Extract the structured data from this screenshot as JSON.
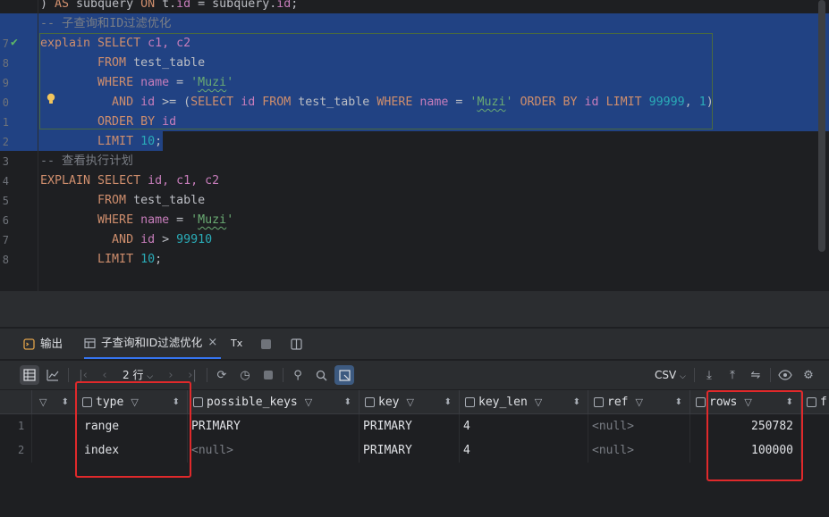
{
  "editor": {
    "lines": [
      {
        "n": "",
        "parts": [
          {
            "t": ") ",
            "c": "id"
          },
          {
            "t": "AS",
            "c": "kw"
          },
          {
            "t": " subquery ",
            "c": "id"
          },
          {
            "t": "ON",
            "c": "kw"
          },
          {
            "t": " t.",
            "c": "id"
          },
          {
            "t": "id",
            "c": "kw2"
          },
          {
            "t": " = subquery.",
            "c": "id"
          },
          {
            "t": "id",
            "c": "kw2"
          },
          {
            "t": ";",
            "c": "id"
          }
        ]
      },
      {
        "n": "",
        "parts": [
          {
            "t": "-- 子查询和ID过滤优化",
            "c": "cm"
          }
        ]
      },
      {
        "n": "7",
        "parts": [
          {
            "t": "explain ",
            "c": "kw"
          },
          {
            "t": "SELECT",
            "c": "kw"
          },
          {
            "t": " c1, c2",
            "c": "kw2"
          }
        ]
      },
      {
        "n": "8",
        "parts": [
          {
            "t": "        FROM",
            "c": "kw"
          },
          {
            "t": " test_table",
            "c": "id"
          }
        ]
      },
      {
        "n": "9",
        "parts": [
          {
            "t": "        WHERE",
            "c": "kw"
          },
          {
            "t": " name",
            "c": "kw2"
          },
          {
            "t": " = ",
            "c": "id"
          },
          {
            "t": "'",
            "c": "str"
          },
          {
            "t": "Muzi",
            "c": "str sq"
          },
          {
            "t": "'",
            "c": "str"
          }
        ]
      },
      {
        "n": "0",
        "parts": [
          {
            "t": "          AND",
            "c": "kw"
          },
          {
            "t": " id",
            "c": "kw2"
          },
          {
            "t": " >= (",
            "c": "id"
          },
          {
            "t": "SELECT",
            "c": "kw"
          },
          {
            "t": " id",
            "c": "kw2"
          },
          {
            "t": " FROM",
            "c": "kw"
          },
          {
            "t": " test_table ",
            "c": "id"
          },
          {
            "t": "WHERE",
            "c": "kw"
          },
          {
            "t": " name",
            "c": "kw2"
          },
          {
            "t": " = ",
            "c": "id"
          },
          {
            "t": "'",
            "c": "str"
          },
          {
            "t": "Muzi",
            "c": "str sq"
          },
          {
            "t": "'",
            "c": "str"
          },
          {
            "t": " ORDER BY",
            "c": "kw"
          },
          {
            "t": " id",
            "c": "kw2"
          },
          {
            "t": " LIMIT",
            "c": "kw"
          },
          {
            "t": " 99999",
            "c": "num"
          },
          {
            "t": ", ",
            "c": "id"
          },
          {
            "t": "1",
            "c": "num"
          },
          {
            "t": ")",
            "c": "id"
          }
        ]
      },
      {
        "n": "1",
        "parts": [
          {
            "t": "        ORDER BY",
            "c": "kw"
          },
          {
            "t": " id",
            "c": "kw2"
          }
        ]
      },
      {
        "n": "2",
        "parts": [
          {
            "t": "        LIMIT",
            "c": "kw"
          },
          {
            "t": " 10",
            "c": "num"
          },
          {
            "t": ";",
            "c": "id"
          }
        ]
      },
      {
        "n": "3",
        "parts": [
          {
            "t": "-- 查看执行计划",
            "c": "cm"
          }
        ]
      },
      {
        "n": "4",
        "parts": [
          {
            "t": "EXPLAIN",
            "c": "kw"
          },
          {
            "t": " SELECT",
            "c": "kw"
          },
          {
            "t": " id, c1, c2",
            "c": "kw2"
          }
        ]
      },
      {
        "n": "5",
        "parts": [
          {
            "t": "        FROM",
            "c": "kw"
          },
          {
            "t": " test_table",
            "c": "id"
          }
        ]
      },
      {
        "n": "6",
        "parts": [
          {
            "t": "        WHERE",
            "c": "kw"
          },
          {
            "t": " name",
            "c": "kw2"
          },
          {
            "t": " = ",
            "c": "id"
          },
          {
            "t": "'",
            "c": "str"
          },
          {
            "t": "Muzi",
            "c": "str sq"
          },
          {
            "t": "'",
            "c": "str"
          }
        ]
      },
      {
        "n": "7",
        "parts": [
          {
            "t": "          AND",
            "c": "kw"
          },
          {
            "t": " id",
            "c": "kw2"
          },
          {
            "t": " > ",
            "c": "id"
          },
          {
            "t": "99910",
            "c": "num"
          }
        ]
      },
      {
        "n": "8",
        "parts": [
          {
            "t": "        LIMIT",
            "c": "kw"
          },
          {
            "t": " 10",
            "c": "num"
          },
          {
            "t": ";",
            "c": "id"
          }
        ]
      }
    ]
  },
  "tabs": {
    "output": "输出",
    "result": "子查询和ID过滤优化",
    "close": "×",
    "tx": "Tx"
  },
  "toolbar": {
    "rows": "2 行",
    "format": "CSV"
  },
  "grid": {
    "columns": [
      "type",
      "possible_keys",
      "key",
      "key_len",
      "ref",
      "rows",
      "f"
    ],
    "rows": [
      {
        "num": "1",
        "type": "range",
        "possible_keys": "PRIMARY",
        "key": "PRIMARY",
        "key_len": "4",
        "ref": "<null>",
        "rows": "250782"
      },
      {
        "num": "2",
        "type": "index",
        "possible_keys": "<null>",
        "key": "PRIMARY",
        "key_len": "4",
        "ref": "<null>",
        "rows": "100000"
      }
    ]
  },
  "colors": {
    "selection": "#214283",
    "highlight_box": "#e0292b",
    "accent": "#3574f0"
  }
}
